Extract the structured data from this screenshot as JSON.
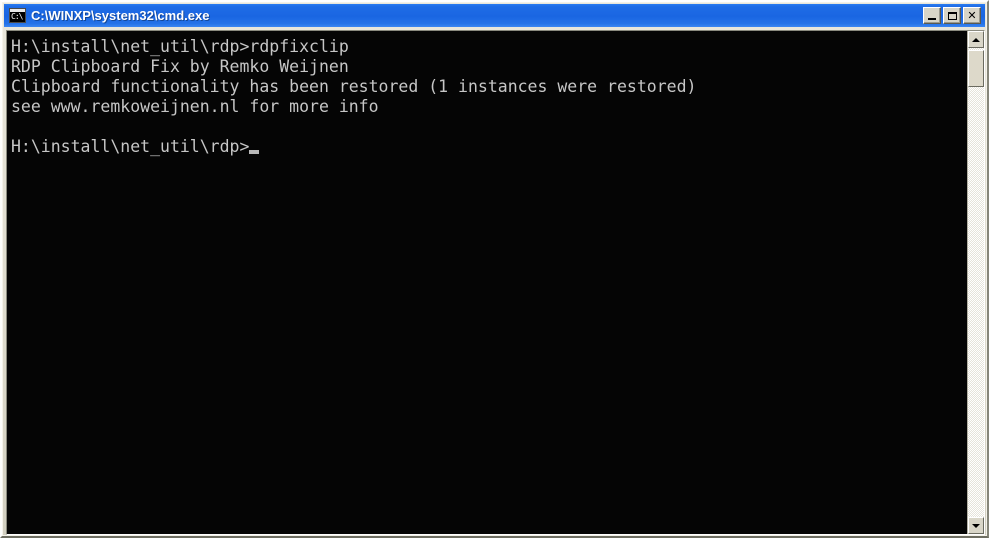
{
  "window": {
    "title": "C:\\WINXP\\system32\\cmd.exe",
    "icon": "cmd-console-icon",
    "icon_prompt_text": "C:\\",
    "titlebar_color": "#1f6ce6",
    "console_background": "#050505",
    "console_foreground": "#c6c6c6"
  },
  "caption_buttons": {
    "minimize_label": "Minimize",
    "maximize_label": "Maximize",
    "close_label": "Close",
    "close_glyph": "✕"
  },
  "console": {
    "lines": [
      "H:\\install\\net_util\\rdp>rdpfixclip",
      "RDP Clipboard Fix by Remko Weijnen",
      "Clipboard functionality has been restored (1 instances were restored)",
      "see www.remkoweijnen.nl for more info",
      "",
      "H:\\install\\net_util\\rdp>"
    ],
    "prompt_line": "H:\\install\\net_util\\rdp>",
    "cursor": "_"
  },
  "scrollbar": {
    "up_arrow": "scroll-up-arrow",
    "down_arrow": "scroll-down-arrow",
    "thumb": "scroll-thumb"
  }
}
